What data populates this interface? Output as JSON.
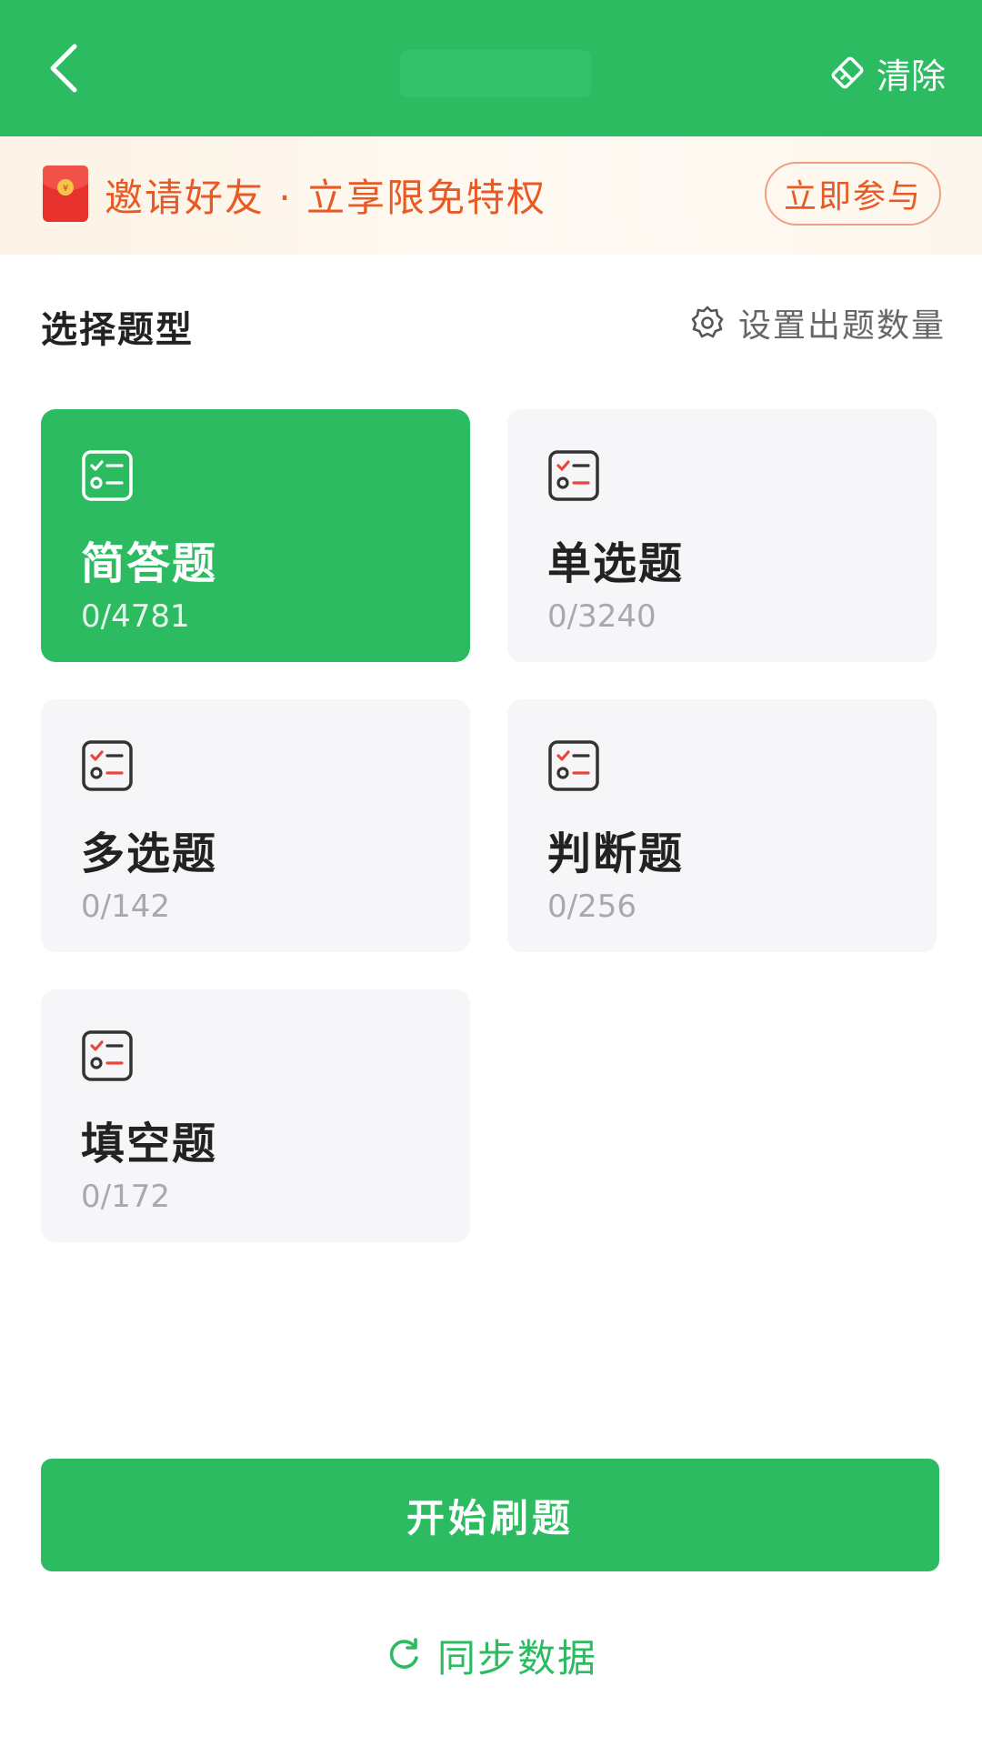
{
  "header": {
    "clear_label": "清除"
  },
  "banner": {
    "text": "邀请好友 · 立享限免特权",
    "button_label": "立即参与"
  },
  "section": {
    "title": "选择题型",
    "settings_label": "设置出题数量"
  },
  "cards": [
    {
      "name": "简答题",
      "count": "0/4781",
      "selected": true
    },
    {
      "name": "单选题",
      "count": "0/3240",
      "selected": false
    },
    {
      "name": "多选题",
      "count": "0/142",
      "selected": false
    },
    {
      "name": "判断题",
      "count": "0/256",
      "selected": false
    },
    {
      "name": "填空题",
      "count": "0/172",
      "selected": false
    }
  ],
  "actions": {
    "start_label": "开始刷题",
    "sync_label": "同步数据"
  },
  "colors": {
    "primary": "#2dbb62",
    "banner_accent": "#e85a25",
    "card_bg": "#f6f6f8",
    "icon_red": "#e8483a"
  },
  "icons": {
    "back": "chevron-left-icon",
    "clear": "eraser-icon",
    "banner": "red-envelope-icon",
    "settings": "gear-icon",
    "card": "checklist-icon",
    "sync": "refresh-icon"
  }
}
